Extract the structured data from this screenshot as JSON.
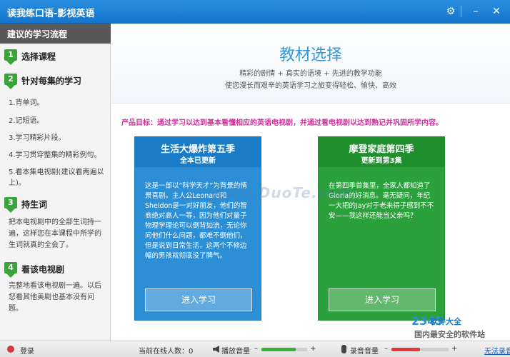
{
  "window": {
    "title": "读我练口语-影视英语"
  },
  "sidebar": {
    "header": "建议的学习流程",
    "steps": [
      {
        "num": "1",
        "title": "选择课程"
      },
      {
        "num": "2",
        "title": "针对每集的学习"
      },
      {
        "num": "3",
        "title": "持生词"
      },
      {
        "num": "4",
        "title": "看该电视剧"
      }
    ],
    "substeps": [
      "1.背单词。",
      "2.记短语。",
      "3.学习精彩片段。",
      "4.学习贯穿整集的精彩例句。",
      "5.看本集电视剧(建议看两遍以上)。"
    ],
    "step3_desc": "把本电视剧中的全部生词持一遍，这样您在本课程中所学的生词就真的全会了。",
    "step4_desc": "完整地看该电视剧一遍。以后您看其他美剧也基本没有问题。"
  },
  "main": {
    "banner_title": "教材选择",
    "banner_line1": "精彩的剧情 + 真实的语境 + 先进的教学功能",
    "banner_line2": "使您漫长而艰辛的英语学习之旅变得轻松、愉快、高效",
    "goal": "产品目标：通过学习以达到基本看懂相应的英语电视剧，并通过看电视剧以达到熟记并巩固所学内容。",
    "watermark": "www.DuoTe.com",
    "cards": [
      {
        "title": "生活大爆炸第五季",
        "subtitle": "全本已更新",
        "body": "这是一部以“科学天才”为背景的情景喜剧。主人公Leonard和Sheldon是一对好朋友，他们的智商绝对高人一等，因为他们对量子物理学理论可以倒背如流，无论你问他们什么问题，都难不倒他们，但是说到日常生活，这两个不修边幅的男孩就彻底没了脾气。",
        "button": "进入学习"
      },
      {
        "title": "摩登家庭第四季",
        "subtitle": "更新到第3集",
        "body": "在第四季首集里，全家人都知道了Gloria的好消息。毫无疑问，年纪一大把的Jay对于老来得子感到不不安——我这样还能当父亲吗？",
        "button": "进入学习"
      }
    ],
    "logo": {
      "mark": "2345",
      "line1": "软件大全",
      "line2": "国内最安全的软件站"
    }
  },
  "statusbar": {
    "login": "登录",
    "online": "当前在线人数：0",
    "play_volume": "播放音量",
    "record_volume": "录音音量",
    "cant_record": "无法录音?",
    "play_level": 0.75,
    "record_level": 0.5
  },
  "colors": {
    "titlebar": "#1a7cc6",
    "card_blue": "#2c8fd6",
    "card_green": "#2ca03c",
    "goal_text": "#cc3399",
    "step_badge": "#3aa33a"
  }
}
